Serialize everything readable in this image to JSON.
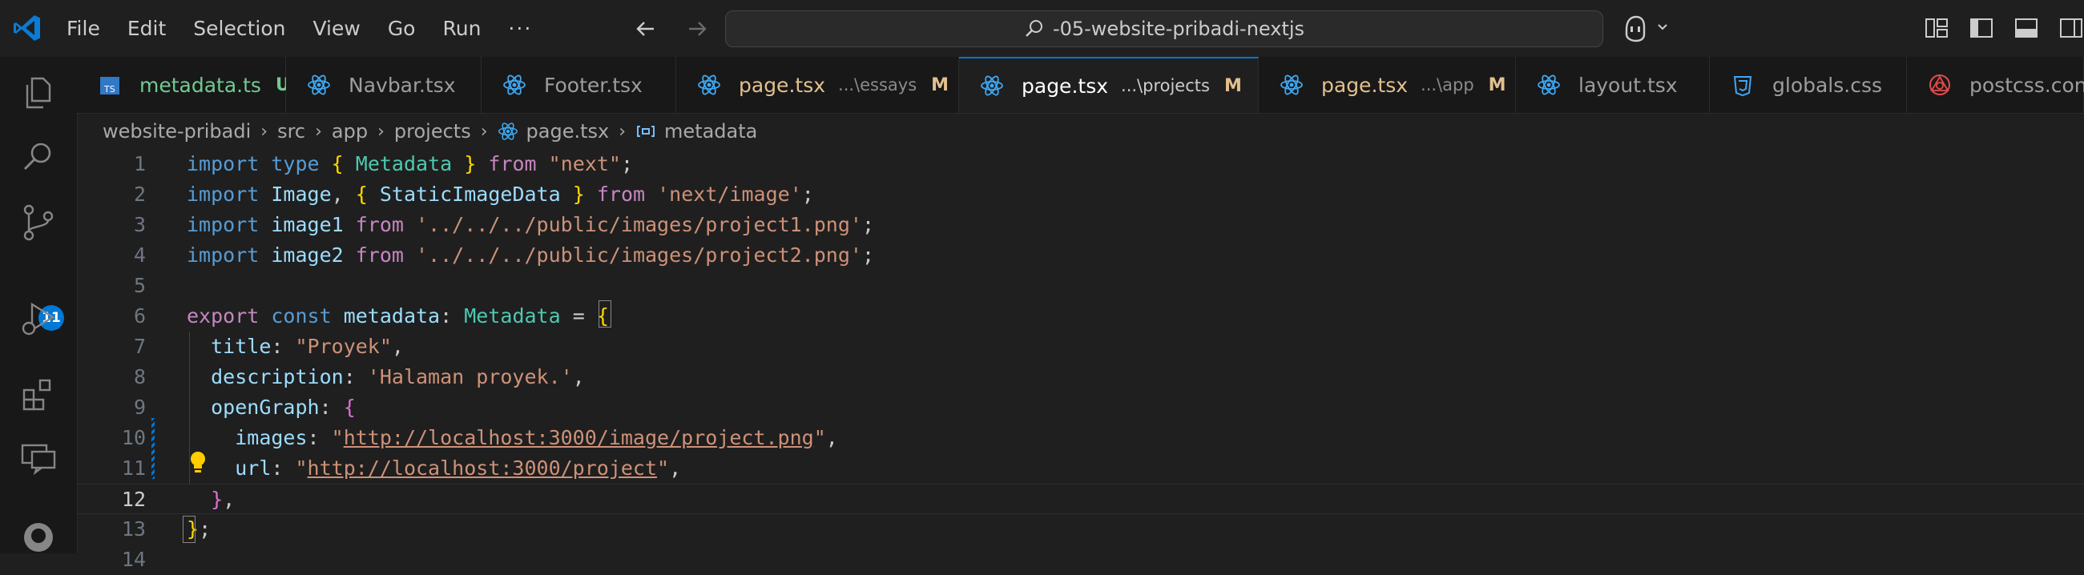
{
  "menu": [
    "File",
    "Edit",
    "Selection",
    "View",
    "Go",
    "Run",
    "···"
  ],
  "command_center": {
    "text": "-05-website-pribadi-nextjs"
  },
  "activity_bar": {
    "icons": [
      "explorer-icon",
      "search-icon",
      "source-control-icon",
      "run-debug-icon",
      "extensions-icon",
      "remote-explorer-icon",
      "github-icon"
    ],
    "source_control_badge": "11"
  },
  "tabs": [
    {
      "name": "metadata.ts",
      "desc": "",
      "badge": "U",
      "icon": "typescript-icon",
      "state": "untracked"
    },
    {
      "name": "Navbar.tsx",
      "desc": "",
      "badge": "",
      "icon": "react-icon",
      "state": "normal"
    },
    {
      "name": "Footer.tsx",
      "desc": "",
      "badge": "",
      "icon": "react-icon",
      "state": "normal"
    },
    {
      "name": "page.tsx",
      "desc": "...\\essays",
      "badge": "M",
      "icon": "react-icon",
      "state": "mod"
    },
    {
      "name": "page.tsx",
      "desc": "...\\projects",
      "badge": "M",
      "icon": "react-icon",
      "state": "active"
    },
    {
      "name": "page.tsx",
      "desc": "...\\app",
      "badge": "M",
      "icon": "react-icon",
      "state": "mod"
    },
    {
      "name": "layout.tsx",
      "desc": "",
      "badge": "",
      "icon": "react-icon",
      "state": "normal"
    },
    {
      "name": "globals.css",
      "desc": "",
      "badge": "",
      "icon": "css-icon",
      "state": "normal"
    },
    {
      "name": "postcss.config.",
      "desc": "",
      "badge": "",
      "icon": "postcss-icon",
      "state": "normal"
    }
  ],
  "breadcrumb": {
    "parts": [
      "website-pribadi",
      "src",
      "app",
      "projects",
      "page.tsx",
      "metadata"
    ]
  },
  "editor": {
    "current_line": 12,
    "line_numbers": [
      "1",
      "2",
      "3",
      "4",
      "5",
      "6",
      "7",
      "8",
      "9",
      "10",
      "11",
      "12",
      "13",
      "14"
    ],
    "lines": [
      [
        [
          "kw",
          "import"
        ],
        [
          "pun",
          " "
        ],
        [
          "kw",
          "type"
        ],
        [
          "pun",
          " "
        ],
        [
          "br1",
          "{"
        ],
        [
          "pun",
          " "
        ],
        [
          "ty",
          "Metadata"
        ],
        [
          "pun",
          " "
        ],
        [
          "br1",
          "}"
        ],
        [
          "pun",
          " "
        ],
        [
          "kw2",
          "from"
        ],
        [
          "pun",
          " "
        ],
        [
          "str",
          "\"next\""
        ],
        [
          "pun",
          ";"
        ]
      ],
      [
        [
          "kw",
          "import"
        ],
        [
          "pun",
          " "
        ],
        [
          "var",
          "Image"
        ],
        [
          "pun",
          ", "
        ],
        [
          "br1",
          "{"
        ],
        [
          "pun",
          " "
        ],
        [
          "var",
          "StaticImageData"
        ],
        [
          "pun",
          " "
        ],
        [
          "br1",
          "}"
        ],
        [
          "pun",
          " "
        ],
        [
          "kw2",
          "from"
        ],
        [
          "pun",
          " "
        ],
        [
          "str",
          "'next/image'"
        ],
        [
          "pun",
          ";"
        ]
      ],
      [
        [
          "kw",
          "import"
        ],
        [
          "pun",
          " "
        ],
        [
          "var",
          "image1"
        ],
        [
          "pun",
          " "
        ],
        [
          "kw2",
          "from"
        ],
        [
          "pun",
          " "
        ],
        [
          "str",
          "'../../../public/images/project1.png'"
        ],
        [
          "pun",
          ";"
        ]
      ],
      [
        [
          "kw",
          "import"
        ],
        [
          "pun",
          " "
        ],
        [
          "var",
          "image2"
        ],
        [
          "pun",
          " "
        ],
        [
          "kw2",
          "from"
        ],
        [
          "pun",
          " "
        ],
        [
          "str",
          "'../../../public/images/project2.png'"
        ],
        [
          "pun",
          ";"
        ]
      ],
      [],
      [
        [
          "kw2",
          "export"
        ],
        [
          "pun",
          " "
        ],
        [
          "kw",
          "const"
        ],
        [
          "pun",
          " "
        ],
        [
          "var",
          "metadata"
        ],
        [
          "pun",
          ": "
        ],
        [
          "ty",
          "Metadata"
        ],
        [
          "pun",
          " = "
        ],
        [
          "br1",
          "{"
        ]
      ],
      [
        [
          "pun",
          "  "
        ],
        [
          "var",
          "title"
        ],
        [
          "pun",
          ": "
        ],
        [
          "str",
          "\"Proyek\""
        ],
        [
          "pun",
          ","
        ]
      ],
      [
        [
          "pun",
          "  "
        ],
        [
          "var",
          "description"
        ],
        [
          "pun",
          ": "
        ],
        [
          "str",
          "'Halaman proyek.'"
        ],
        [
          "pun",
          ","
        ]
      ],
      [
        [
          "pun",
          "  "
        ],
        [
          "var",
          "openGraph"
        ],
        [
          "pun",
          ": "
        ],
        [
          "br2",
          "{"
        ]
      ],
      [
        [
          "pun",
          "    "
        ],
        [
          "var",
          "images"
        ],
        [
          "pun",
          ": "
        ],
        [
          "str",
          "\""
        ],
        [
          "str url",
          "http://localhost:3000/image/project.png"
        ],
        [
          "str",
          "\""
        ],
        [
          "pun",
          ","
        ]
      ],
      [
        [
          "pun",
          "    "
        ],
        [
          "var",
          "url"
        ],
        [
          "pun",
          ": "
        ],
        [
          "str",
          "\""
        ],
        [
          "str url",
          "http://localhost:3000/project"
        ],
        [
          "str",
          "\""
        ],
        [
          "pun",
          ","
        ]
      ],
      [
        [
          "pun",
          "  "
        ],
        [
          "br2",
          "}"
        ],
        [
          "pun",
          ","
        ]
      ],
      [
        [
          "br1",
          "}"
        ],
        [
          "pun",
          ";"
        ]
      ],
      []
    ]
  },
  "colors": {
    "accent": "#0078d4",
    "modified": "#e2c08d",
    "untracked": "#73c991"
  }
}
